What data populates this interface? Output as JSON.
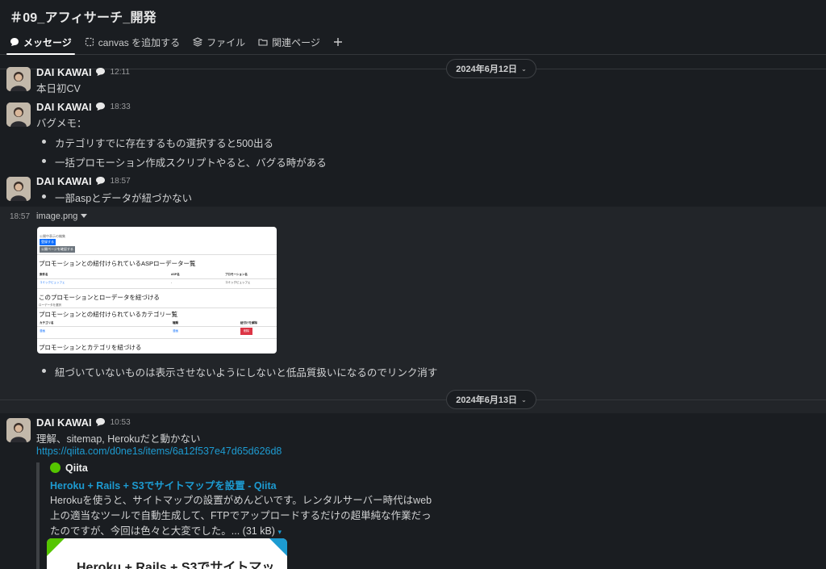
{
  "channel": {
    "title": "＃09_アフィサーチ_開発"
  },
  "tabs": [
    {
      "label": "メッセージ",
      "icon": "message-bubble-icon"
    },
    {
      "label": "canvas を追加する",
      "icon": "canvas-icon"
    },
    {
      "label": "ファイル",
      "icon": "layers-icon"
    },
    {
      "label": "関連ページ",
      "icon": "folder-icon"
    }
  ],
  "dividers": {
    "d1": "2024年6月12日",
    "d2": "2024年6月13日"
  },
  "messages": {
    "m1": {
      "author": "DAI KAWAI",
      "time": "12:11",
      "text": "本日初CV"
    },
    "m2": {
      "author": "DAI KAWAI",
      "time": "18:33",
      "text": "バグメモ：",
      "bullets": [
        "カテゴリすでに存在するもの選択すると500出る",
        "一括プロモーション作成スクリプトやると、バグる時がある"
      ]
    },
    "m3": {
      "author": "DAI KAWAI",
      "time": "18:57",
      "bullets": [
        "一部aspとデータが紐づかない"
      ]
    },
    "file": {
      "time": "18:57",
      "name": "image.png",
      "preview": {
        "top_note": "公開中表示の編集",
        "button_blue": "登録する",
        "button_gray": "公開ページを確認する",
        "h1": "プロモーションとの紐付けられているASPローデーター覧",
        "table1_headers": [
          "案件名",
          "ASP名",
          "プロモーション名"
        ],
        "table1_row": [
          "コミックビュッフェ",
          "-",
          "コミックビュッフェ"
        ],
        "h2": "このプロモーションとローデータを紐づける",
        "note2": "ローデータを選択",
        "h3": "プロモーションとの紐付けられているカテゴリー覧",
        "table2_headers": [
          "カテゴリ名",
          "種類",
          "紐付けを解除"
        ],
        "table2_row": [
          "漫画",
          "漫画",
          "削除"
        ],
        "h4": "プロモーションとカテゴリを紐づける"
      }
    },
    "m3_after": "紐づいていないものは表示させないようにしないと低品質扱いになるのでリンク消す",
    "m4": {
      "author": "DAI KAWAI",
      "time": "10:53",
      "text": "理解、sitemap, Herokuだと動かない",
      "link": "https://qiita.com/d0ne1s/items/6a12f537e47d65d626d8",
      "unfurl": {
        "site": "Qiita",
        "title": "Heroku + Rails + S3でサイトマップを設置 - Qiita",
        "desc": "Herokuを使うと、サイトマップの設置がめんどいです。レンタルサーバー時代はweb上の適当なツールで自動生成して、FTPでアップロードするだけの超単純な作業だったのですが、今回は色々と大変でした。...",
        "size": "(31 kB)",
        "image_text": "Heroku + Rails + S3でサイトマッ"
      }
    }
  },
  "colors": {
    "background": "#1a1d21",
    "link": "#1d9bd1",
    "qiita": "#55c500"
  }
}
